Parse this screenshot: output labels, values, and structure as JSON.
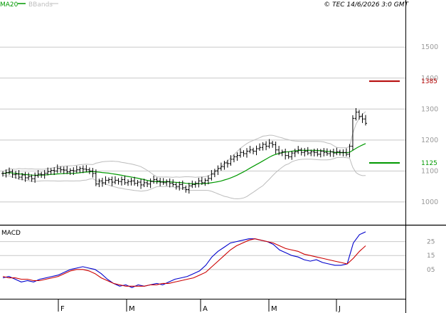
{
  "header": {
    "legend": [
      {
        "label": "MA20",
        "color": "#009900"
      },
      {
        "label": "BBands",
        "color": "#bdbdbd"
      }
    ],
    "timestamp": "© TEC 14/6/2026 3:0 GMT"
  },
  "chart_data": [
    {
      "type": "ohlc",
      "panel": "price",
      "y_ticks": [
        1000,
        1100,
        1200,
        1300,
        1400,
        1500
      ],
      "y_tick_labels": [
        "1000",
        "1100",
        "1200",
        "1300",
        "1400",
        "1500"
      ],
      "ylim": [
        940,
        1620
      ],
      "x_labels": [
        "F",
        "M",
        "A",
        "M",
        "J"
      ],
      "grid": true,
      "bars_approx_close": [
        1092,
        1095,
        1098,
        1088,
        1090,
        1080,
        1087,
        1078,
        1082,
        1075,
        1085,
        1090,
        1088,
        1093,
        1098,
        1102,
        1100,
        1108,
        1104,
        1103,
        1097,
        1102,
        1100,
        1104,
        1108,
        1106,
        1104,
        1100,
        1092,
        1058,
        1068,
        1062,
        1070,
        1072,
        1064,
        1070,
        1066,
        1072,
        1062,
        1066,
        1068,
        1060,
        1064,
        1055,
        1062,
        1058,
        1066,
        1072,
        1068,
        1064,
        1062,
        1066,
        1060,
        1056,
        1050,
        1056,
        1046,
        1040,
        1052,
        1056,
        1060,
        1068,
        1062,
        1070,
        1076,
        1090,
        1100,
        1108,
        1114,
        1126,
        1124,
        1138,
        1146,
        1150,
        1160,
        1156,
        1164,
        1168,
        1164,
        1172,
        1176,
        1186,
        1180,
        1190,
        1185,
        1168,
        1158,
        1162,
        1150,
        1146,
        1158,
        1162,
        1168,
        1160,
        1164,
        1158,
        1162,
        1160,
        1154,
        1164,
        1160,
        1156,
        1162,
        1158,
        1162,
        1160,
        1160,
        1154,
        1180,
        1270,
        1290,
        1276,
        1268,
        1254
      ],
      "levels": [
        {
          "label": "1385",
          "value": 1390,
          "color": "#b30000"
        },
        {
          "label": "1125",
          "value": 1126,
          "color": "#009900"
        }
      ]
    },
    {
      "type": "line",
      "panel": "macd",
      "title": "MACD",
      "y_ticks": [
        5,
        15,
        25
      ],
      "y_tick_labels": [
        "05",
        "15",
        "25"
      ],
      "ylim": [
        -15,
        34
      ],
      "series": [
        {
          "color": "#0000cc",
          "values": [
            -1,
            0,
            -2,
            -4,
            -3,
            -4,
            -2,
            -1,
            0,
            1,
            3,
            5,
            6,
            7,
            6,
            5,
            2,
            -2,
            -5,
            -7,
            -6,
            -8,
            -6,
            -7,
            -6,
            -5,
            -6,
            -4,
            -2,
            -1,
            0,
            2,
            4,
            8,
            14,
            18,
            21,
            24,
            25,
            26,
            27,
            27,
            26,
            25,
            23,
            19,
            17,
            15,
            14,
            12,
            11,
            12,
            10,
            9,
            8,
            8,
            9,
            24,
            30,
            32
          ]
        },
        {
          "color": "#cc0000",
          "values": [
            0,
            -1,
            -1,
            -2,
            -2,
            -3,
            -3,
            -2,
            -1,
            0,
            2,
            4,
            5,
            5,
            4,
            2,
            -1,
            -3,
            -5,
            -6,
            -7,
            -7,
            -7,
            -7,
            -6,
            -6,
            -5,
            -5,
            -4,
            -3,
            -2,
            -1,
            1,
            3,
            7,
            11,
            15,
            19,
            22,
            24,
            26,
            27,
            26,
            25,
            24,
            22,
            20,
            19,
            18,
            16,
            15,
            14,
            13,
            12,
            11,
            10,
            9,
            13,
            18,
            22
          ]
        }
      ]
    }
  ]
}
